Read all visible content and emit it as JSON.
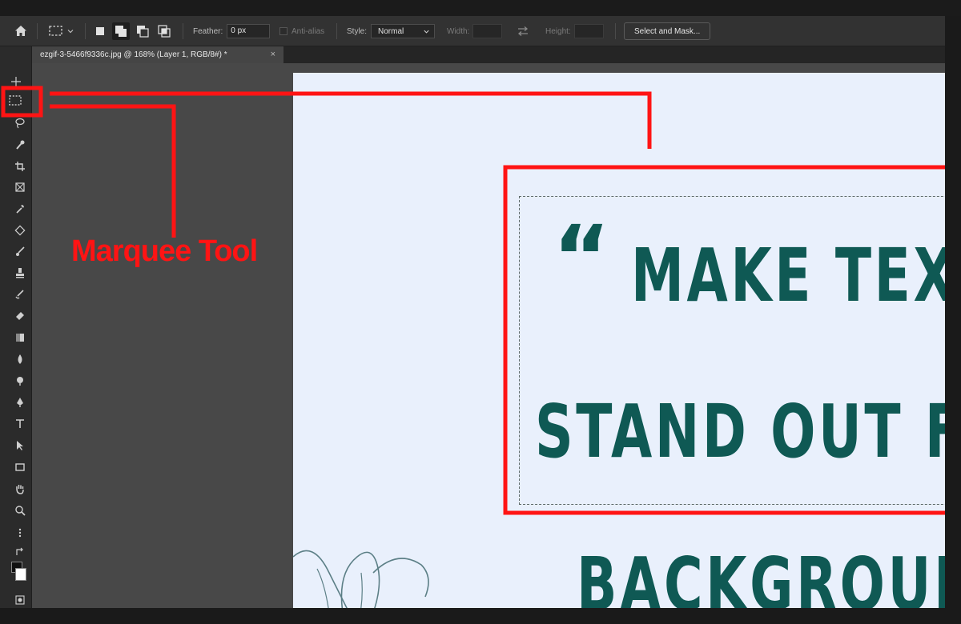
{
  "options_bar": {
    "feather_label": "Feather:",
    "feather_value": "0 px",
    "anti_alias_label": "Anti-alias",
    "style_label": "Style:",
    "style_value": "Normal",
    "width_label": "Width:",
    "height_label": "Height:",
    "select_and_mask_label": "Select and Mask..."
  },
  "document_tab": {
    "title": "ezgif-3-5466f9336c.jpg @ 168% (Layer 1, RGB/8#) *",
    "close_glyph": "×"
  },
  "canvas": {
    "quote_mark": "“",
    "line1": "MAKE TEX",
    "line2": "STAND OUT FI",
    "line3": "BACKGROUN",
    "text_color": "#0f5954",
    "background_color": "#e9f0fc"
  },
  "annotation": {
    "label": "Marquee Tool",
    "color": "#ff1414"
  },
  "icons": {
    "home": "home-icon",
    "marquee": "rectangular-marquee-icon",
    "new_selection": "new-selection-icon",
    "add_selection": "add-to-selection-icon",
    "subtract_selection": "subtract-from-selection-icon",
    "intersect_selection": "intersect-selection-icon",
    "swap": "swap-dimensions-icon"
  }
}
